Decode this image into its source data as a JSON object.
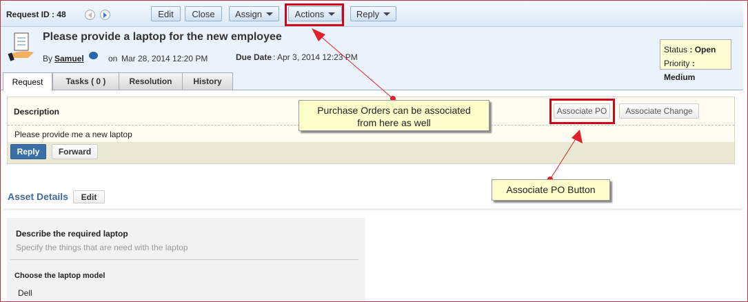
{
  "toolbar": {
    "request_id": "Request ID : 48",
    "edit": "Edit",
    "close": "Close",
    "assign": "Assign",
    "actions": "Actions",
    "reply": "Reply"
  },
  "request": {
    "title": "Please provide a laptop for the new employee",
    "by": "By",
    "author": "Samuel",
    "on": "on",
    "created": "Mar 28, 2014 12:20 PM",
    "due_label": "Due Date",
    "due_value": ": Apr 3, 2014 12:23 PM"
  },
  "status": {
    "status_label": "Status",
    "status_value": ": Open",
    "priority_label": "Priority",
    "priority_value": ": Medium"
  },
  "tabs": [
    {
      "label": "Request"
    },
    {
      "label": "Tasks ( 0 )"
    },
    {
      "label": "Resolution"
    },
    {
      "label": "History"
    }
  ],
  "description": {
    "heading": "Description",
    "text": "Please provide me a new laptop",
    "associate_po": "Associate PO",
    "associate_change": "Associate Change",
    "reply": "Reply",
    "forward": "Forward"
  },
  "asset": {
    "heading": "Asset Details",
    "edit": "Edit",
    "q1": "Describe the required laptop",
    "q1_hint": "Specify the things that are need with the laptop",
    "q2": "Choose the laptop model",
    "q2_value": "Dell"
  },
  "annotations": {
    "callout1_line1": "Purchase Orders can be associated",
    "callout1_line2": "from here as well",
    "callout2": "Associate PO Button"
  },
  "colors": {
    "highlight": "#d0021b",
    "callout_bg": "#fefecd",
    "reply_btn": "#3a6fa8"
  }
}
